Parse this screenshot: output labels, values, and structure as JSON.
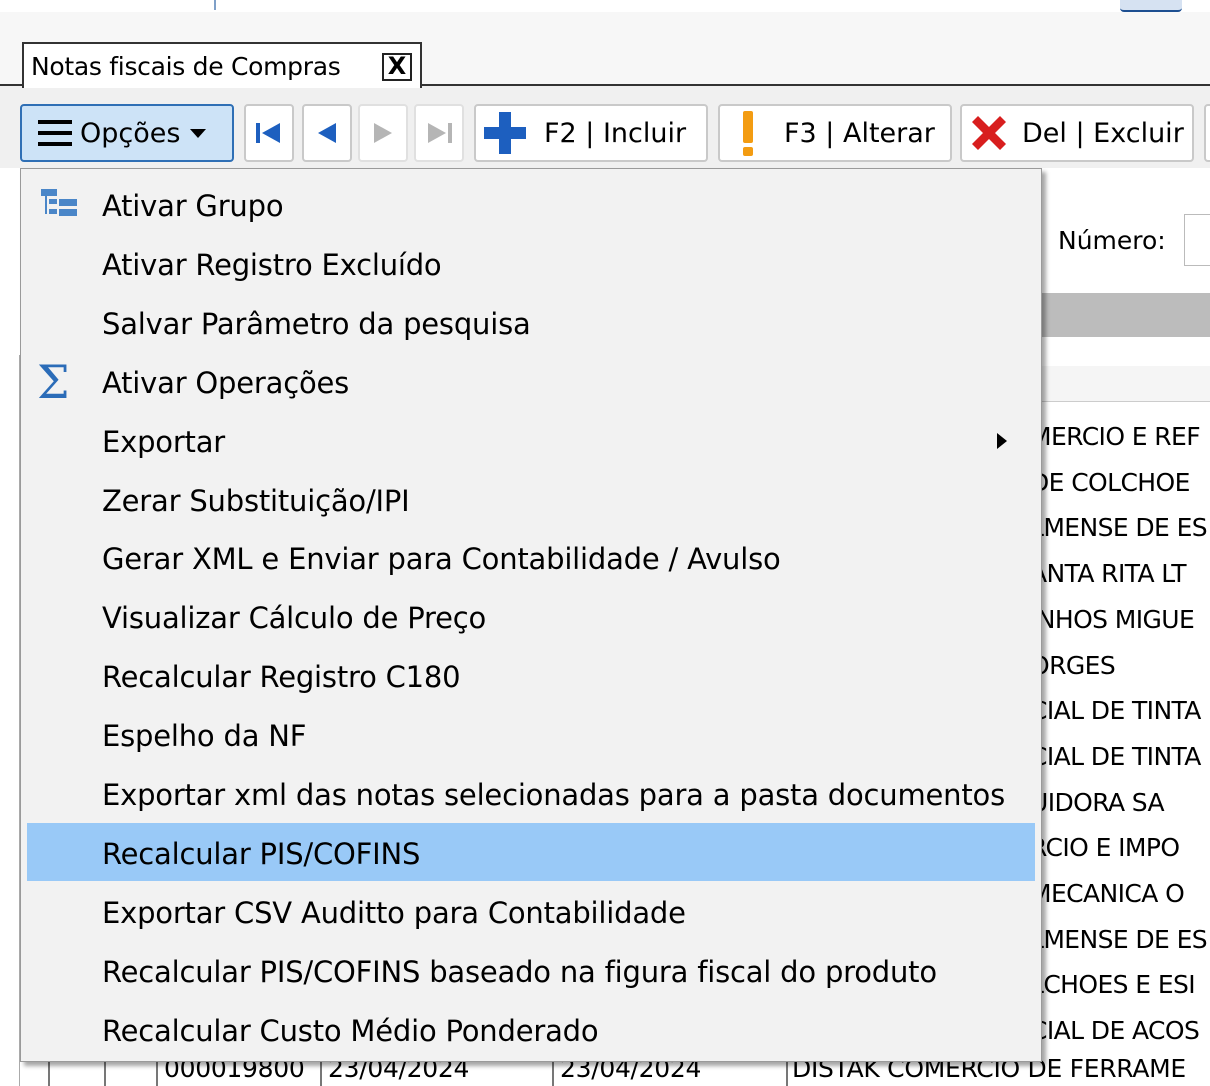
{
  "tab": {
    "title": "Notas fiscais de Compras",
    "close": "X"
  },
  "toolbar": {
    "opcoes_label": "Opções",
    "incluir_label": "F2 | Incluir",
    "alterar_label": "F3 | Alterar",
    "excluir_label": "Del | Excluir"
  },
  "filter": {
    "numero_label": "Número:"
  },
  "menu": {
    "items": [
      {
        "label": "Ativar Grupo",
        "icon": "tree-group-icon"
      },
      {
        "label": "Ativar Registro Excluído"
      },
      {
        "label": "Salvar Parâmetro da pesquisa"
      },
      {
        "label": "Ativar Operações",
        "icon": "sigma-icon"
      },
      {
        "label": "Exportar",
        "submenu": true
      },
      {
        "label": "Zerar Substituição/IPI"
      },
      {
        "label": "Gerar XML e Enviar para Contabilidade / Avulso"
      },
      {
        "label": "Visualizar Cálculo de Preço"
      },
      {
        "label": "Recalcular Registro C180"
      },
      {
        "label": "Espelho da NF"
      },
      {
        "label": "Exportar xml das notas selecionadas para a pasta documentos"
      },
      {
        "label": "Recalcular PIS/COFINS",
        "highlighted": true
      },
      {
        "label": "Exportar CSV Auditto para Contabilidade"
      },
      {
        "label": "Recalcular PIS/COFINS baseado na figura fiscal do produto"
      },
      {
        "label": "Recalcular Custo Médio Ponderado"
      }
    ]
  },
  "grid_rows_partial": [
    "MERCIO E REF",
    "DE COLCHOE",
    "LMENSE DE ES",
    "ANTA RITA LT",
    "INHOS MIGUE",
    "ORGES",
    "CIAL DE TINTA",
    "CIAL DE TINTA",
    "UIDORA SA",
    "RCIO E IMPO",
    "MECANICA O",
    "LMENSE DE ES",
    "LCHOES E ESI",
    "CIAL DE ACOS"
  ],
  "last_row": {
    "numero": "000019800",
    "emissao": "23/04/2024",
    "entrada": "23/04/2024",
    "fornecedor": "DISTAK COMERCIO DE FERRAME"
  },
  "colors": {
    "highlight": "#99c9f7",
    "opcoes_bg": "#cde3f7",
    "accent_blue": "#1d5fbf",
    "excluir_red": "#d81e1e",
    "alterar_orange": "#f39c12"
  }
}
